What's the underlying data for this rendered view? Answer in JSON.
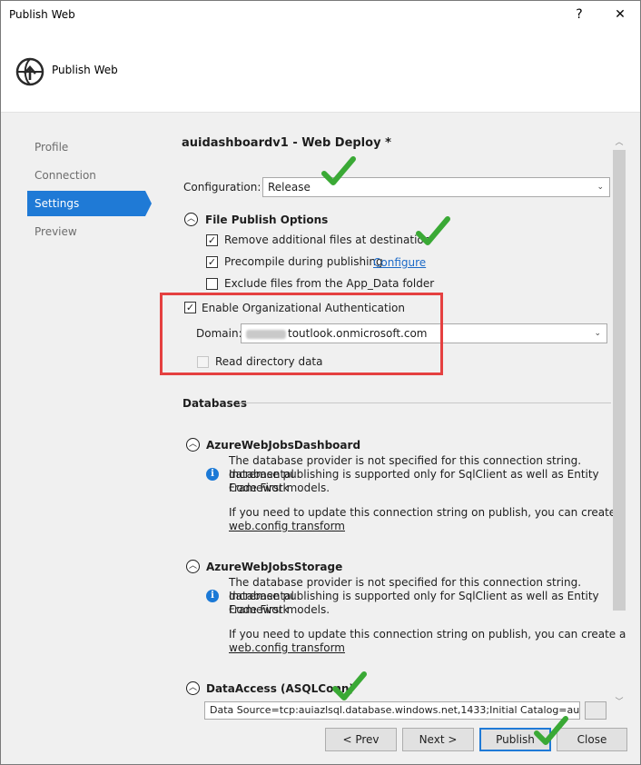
{
  "window": {
    "title": "Publish Web",
    "help_glyph": "?",
    "close_glyph": "✕"
  },
  "header": {
    "title": "Publish Web",
    "icon": "globe-publish-icon"
  },
  "nav": {
    "items": [
      {
        "label": "Profile"
      },
      {
        "label": "Connection"
      },
      {
        "label": "Settings",
        "active": true
      },
      {
        "label": "Preview"
      }
    ]
  },
  "settings": {
    "profile_title": "auidashboardv1 - Web Deploy *",
    "configuration_label": "Configuration:",
    "configuration_value": "Release",
    "file_publish": {
      "header": "File Publish Options",
      "remove_files_label": "Remove additional files at destination",
      "remove_files_checked": true,
      "precompile_label": "Precompile during publishing",
      "precompile_checked": true,
      "configure_link": "Configure",
      "exclude_appdata_label": "Exclude files from the App_Data folder",
      "exclude_appdata_checked": false
    },
    "org_auth": {
      "enable_label": "Enable Organizational Authentication",
      "enable_checked": true,
      "domain_label": "Domain:",
      "domain_value": "toutlook.onmicrosoft.com",
      "read_directory_label": "Read directory data",
      "read_directory_checked": false
    },
    "databases": {
      "header": "Databases",
      "items": [
        {
          "name": "AzureWebJobsDashboard",
          "info_line1": "The database provider is not specified for this connection string. Incremental",
          "info_line2": "database publishing is supported only for SqlClient as well as Entity Framework",
          "info_line3": "Code First models.",
          "update_text": "If you need to update this connection string on publish, you can create a",
          "transform_link": "web.config transform"
        },
        {
          "name": "AzureWebJobsStorage",
          "info_line1": "The database provider is not specified for this connection string. Incremental",
          "info_line2": "database publishing is supported only for SqlClient as well as Entity Framework",
          "info_line3": "Code First models.",
          "update_text": "If you need to update this connection string on publish, you can create a",
          "transform_link": "web.config transform"
        },
        {
          "name": "DataAccess (ASQLConn)",
          "connection_value": "Data Source=tcp:auiazlsql.database.windows.net,1433;Initial Catalog=au"
        }
      ]
    }
  },
  "buttons": {
    "prev": "< Prev",
    "next": "Next >",
    "publish": "Publish",
    "close": "Close"
  },
  "colors": {
    "accent": "#1f7ad6",
    "annotation_red": "#e54040",
    "annotation_check": "#3aa935",
    "link": "#1c6ac7"
  }
}
